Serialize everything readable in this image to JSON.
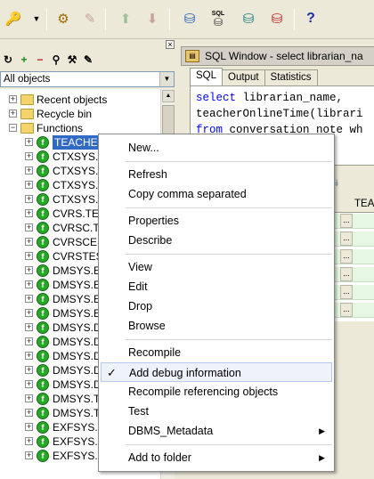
{
  "toolbar": {
    "icons": [
      "key-icon",
      "dropdown-arrow-icon",
      "gear-icon",
      "pen-icon",
      "upload-icon",
      "download-icon",
      "db-icon",
      "sql-db-icon",
      "db-sync-icon",
      "db-stop-icon",
      "help-icon"
    ],
    "help_label": "?",
    "sql_label": "SQL"
  },
  "object_browser": {
    "filter_value": "All objects",
    "tree": [
      {
        "label": "Recent objects",
        "type": "folder",
        "expander": "+",
        "level": 0
      },
      {
        "label": "Recycle bin",
        "type": "folder",
        "expander": "+",
        "level": 0
      },
      {
        "label": "Functions",
        "type": "folder",
        "expander": "−",
        "level": 0
      },
      {
        "label": "TEACHERONLINETIME",
        "type": "function",
        "expander": "+",
        "level": 1,
        "selected": true
      },
      {
        "label": "CTXSYS.",
        "type": "function",
        "expander": "+",
        "level": 1
      },
      {
        "label": "CTXSYS.",
        "type": "function",
        "expander": "+",
        "level": 1
      },
      {
        "label": "CTXSYS.",
        "type": "function",
        "expander": "+",
        "level": 1
      },
      {
        "label": "CTXSYS.",
        "type": "function",
        "expander": "+",
        "level": 1
      },
      {
        "label": "CVRS.TE",
        "type": "function",
        "expander": "+",
        "level": 1
      },
      {
        "label": "CVRSC.T",
        "type": "function",
        "expander": "+",
        "level": 1
      },
      {
        "label": "CVRSCE",
        "type": "function",
        "expander": "+",
        "level": 1
      },
      {
        "label": "CVRSTES",
        "type": "function",
        "expander": "+",
        "level": 1
      },
      {
        "label": "DMSYS.E",
        "type": "function",
        "expander": "+",
        "level": 1
      },
      {
        "label": "DMSYS.E",
        "type": "function",
        "expander": "+",
        "level": 1
      },
      {
        "label": "DMSYS.E",
        "type": "function",
        "expander": "+",
        "level": 1
      },
      {
        "label": "DMSYS.E",
        "type": "function",
        "expander": "+",
        "level": 1
      },
      {
        "label": "DMSYS.D",
        "type": "function",
        "expander": "+",
        "level": 1
      },
      {
        "label": "DMSYS.D",
        "type": "function",
        "expander": "+",
        "level": 1
      },
      {
        "label": "DMSYS.D",
        "type": "function",
        "expander": "+",
        "level": 1
      },
      {
        "label": "DMSYS.D",
        "type": "function",
        "expander": "+",
        "level": 1
      },
      {
        "label": "DMSYS.D",
        "type": "function",
        "expander": "+",
        "level": 1
      },
      {
        "label": "DMSYS.T",
        "type": "function",
        "expander": "+",
        "level": 1
      },
      {
        "label": "DMSYS.T",
        "type": "function",
        "expander": "+",
        "level": 1
      },
      {
        "label": "EXFSYS.",
        "type": "function",
        "expander": "+",
        "level": 1
      },
      {
        "label": "EXFSYS.",
        "type": "function",
        "expander": "+",
        "level": 1
      },
      {
        "label": "EXFSYS.EVALUATE_C",
        "type": "function",
        "expander": "+",
        "level": 1
      }
    ]
  },
  "sql_window": {
    "title": "SQL Window - select librarian_na",
    "tabs": [
      "SQL",
      "Output",
      "Statistics"
    ],
    "active_tab": "SQL",
    "lines": [
      {
        "kw": "select",
        "rest": " librarian_name,"
      },
      {
        "kw": "",
        "rest": "teacherOnlineTime(librari"
      },
      {
        "kw": "from",
        "rest": " conversation_note wh"
      }
    ],
    "grid_column": "TEA",
    "grid_cell": "..."
  },
  "context_menu": {
    "items": [
      {
        "label": "New...",
        "type": "item"
      },
      {
        "type": "separator"
      },
      {
        "label": "Refresh",
        "type": "item"
      },
      {
        "label": "Copy comma separated",
        "type": "item"
      },
      {
        "type": "separator"
      },
      {
        "label": "Properties",
        "type": "item"
      },
      {
        "label": "Describe",
        "type": "item"
      },
      {
        "type": "separator"
      },
      {
        "label": "View",
        "type": "item"
      },
      {
        "label": "Edit",
        "type": "item"
      },
      {
        "label": "Drop",
        "type": "item"
      },
      {
        "label": "Browse",
        "type": "item"
      },
      {
        "type": "separator"
      },
      {
        "label": "Recompile",
        "type": "item"
      },
      {
        "label": "Add debug information",
        "type": "item",
        "checked": true,
        "highlighted": true
      },
      {
        "label": "Recompile referencing objects",
        "type": "item"
      },
      {
        "label": "Test",
        "type": "item"
      },
      {
        "label": "DBMS_Metadata",
        "type": "item",
        "submenu": true
      },
      {
        "type": "separator"
      },
      {
        "label": "Add to folder",
        "type": "item",
        "submenu": true
      }
    ],
    "check_glyph": "✓",
    "submenu_glyph": "▶"
  }
}
